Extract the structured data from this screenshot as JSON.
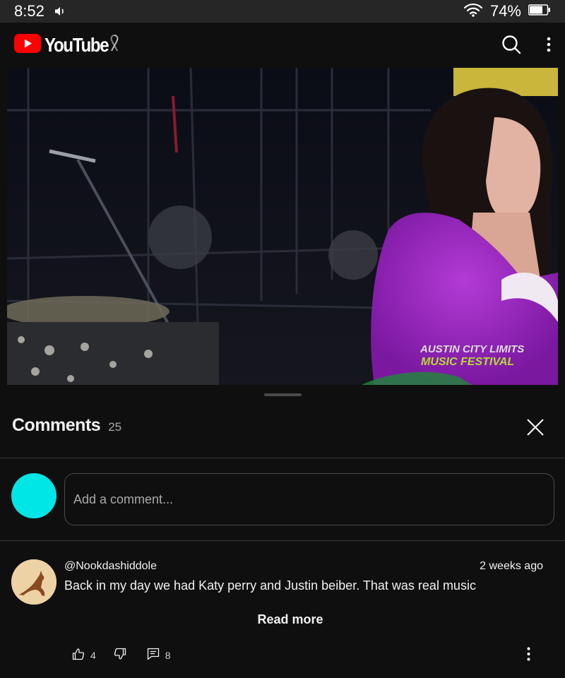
{
  "status_bar": {
    "time": "8:52",
    "battery": "74%",
    "icons": [
      "volume-icon",
      "wifi-icon",
      "battery-icon"
    ]
  },
  "app_bar": {
    "logo_text": "YouTube",
    "icons": [
      "youtube-logo-icon",
      "awareness-ribbon-icon",
      "search-icon",
      "more-vert-icon"
    ]
  },
  "video": {
    "overlay_line1": "AUSTIN CITY LIMITS",
    "overlay_line2": "MUSIC FESTIVAL"
  },
  "comments": {
    "title": "Comments",
    "count": "25",
    "input_placeholder": "Add a comment...",
    "items": [
      {
        "author": "@Nookdashiddole",
        "time": "2 weeks ago",
        "text": "Back in my day we had Katy perry and Justin beiber. That was real music",
        "read_more": "Read more",
        "likes": "4",
        "replies": "8"
      }
    ]
  },
  "colors": {
    "background": "#0f0f0f",
    "status_bar": "#262626",
    "brand_red": "#ff0000",
    "my_avatar": "#00e5e5",
    "text": "#f1f1f1",
    "muted": "#aaaaaa"
  }
}
